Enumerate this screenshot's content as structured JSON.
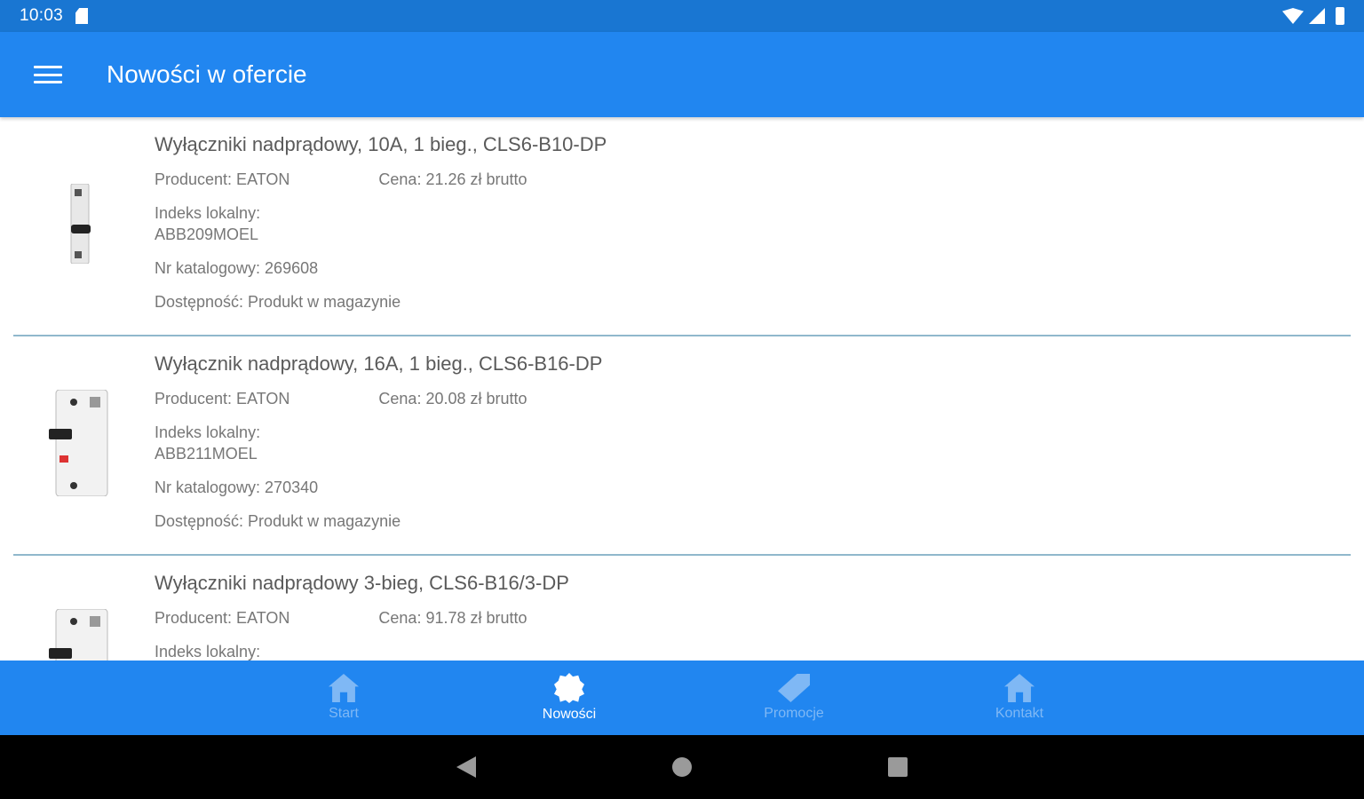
{
  "status_bar": {
    "time": "10:03"
  },
  "app_bar": {
    "title": "Nowości w ofercie"
  },
  "products": [
    {
      "name": "Wyłączniki nadprądowy, 10A, 1 bieg., CLS6-B10-DP",
      "producer": "Producent: EATON",
      "price": "Cena: 21.26 zł brutto",
      "indeks_label": "Indeks lokalny:",
      "indeks_value": "ABB209MOEL",
      "catalog": "Nr katalogowy: 269608",
      "availability": "Dostępność: Produkt w magazynie"
    },
    {
      "name": "Wyłącznik nadprądowy, 16A, 1 bieg., CLS6-B16-DP",
      "producer": "Producent: EATON",
      "price": "Cena: 20.08 zł brutto",
      "indeks_label": "Indeks lokalny:",
      "indeks_value": "ABB211MOEL",
      "catalog": "Nr katalogowy: 270340",
      "availability": "Dostępność: Produkt w magazynie"
    },
    {
      "name": "Wyłączniki nadprądowy 3-bieg, CLS6-B16/3-DP",
      "producer": "Producent: EATON",
      "price": "Cena: 91.78 zł brutto",
      "indeks_label": "Indeks lokalny:"
    }
  ],
  "bottom_nav": {
    "items": [
      {
        "label": "Start",
        "icon": "home-icon"
      },
      {
        "label": "Nowości",
        "icon": "new-badge-icon"
      },
      {
        "label": "Promocje",
        "icon": "tag-icon"
      },
      {
        "label": "Kontakt",
        "icon": "home-icon"
      }
    ],
    "active_index": 1
  },
  "colors": {
    "status_bar": "#1976d2",
    "primary": "#2186f0",
    "nav_inactive": "#7fb8f5",
    "divider": "#90b8cc"
  }
}
